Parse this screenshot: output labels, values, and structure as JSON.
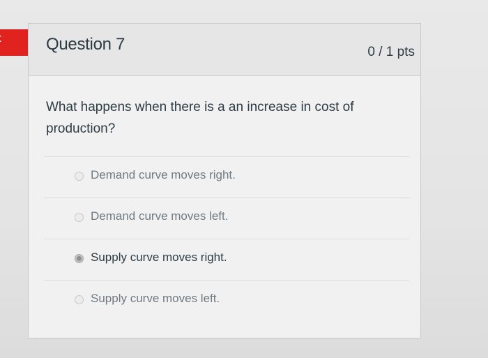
{
  "flag": {
    "text": "t",
    "color": "#e0231f"
  },
  "question": {
    "title": "Question 7",
    "points": "0 / 1 pts",
    "text": "What happens when there is a an increase in cost of production?"
  },
  "answers": [
    {
      "label": "Demand curve moves right.",
      "selected": false
    },
    {
      "label": "Demand curve moves left.",
      "selected": false
    },
    {
      "label": "Supply curve moves right.",
      "selected": true
    },
    {
      "label": "Supply curve moves left.",
      "selected": false
    }
  ]
}
